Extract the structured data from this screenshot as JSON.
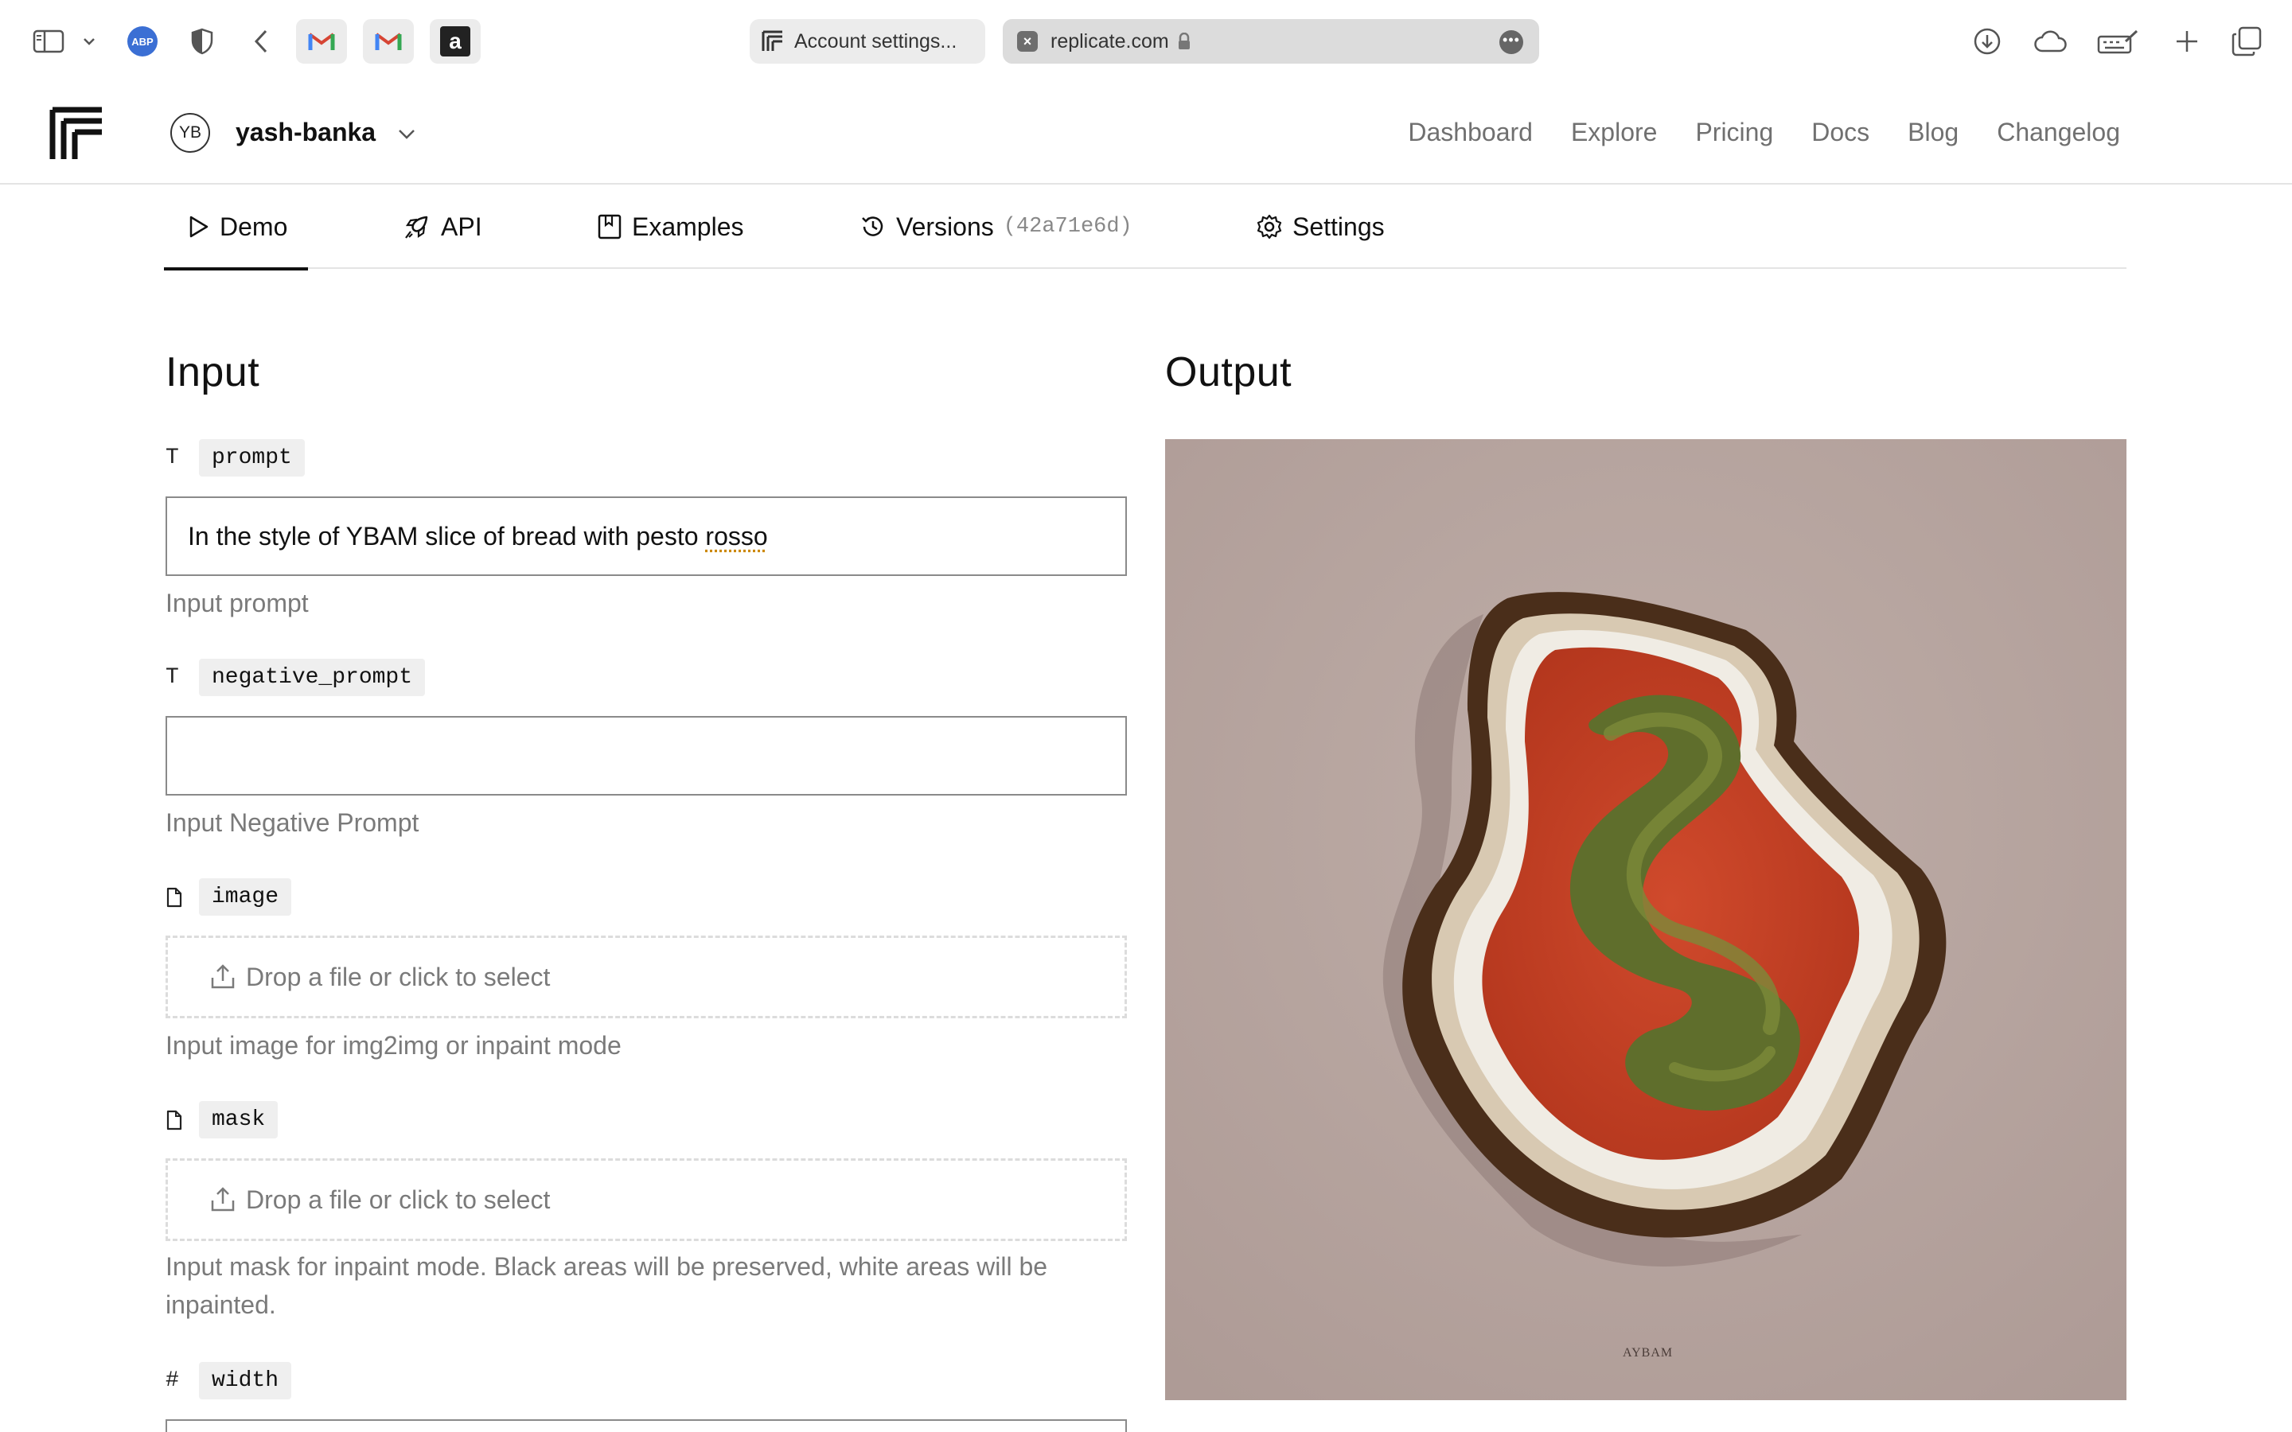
{
  "browser": {
    "tab_inactive_title": "Account settings...",
    "tab_active_url": "replicate.com",
    "adblock_label": "ABP",
    "amazon_label": "a"
  },
  "header": {
    "avatar_initials": "YB",
    "username": "yash-banka",
    "nav": [
      "Dashboard",
      "Explore",
      "Pricing",
      "Docs",
      "Blog",
      "Changelog"
    ]
  },
  "model_tabs": {
    "demo": "Demo",
    "api": "API",
    "examples": "Examples",
    "versions": "Versions",
    "version_hash": "(42a71e6d)",
    "settings": "Settings"
  },
  "input": {
    "title": "Input",
    "fields": {
      "prompt": {
        "type_icon": "T",
        "name": "prompt",
        "value_prefix": "In the style of YBAM slice of bread with pesto ",
        "value_flagged_word": "rosso",
        "hint": "Input prompt"
      },
      "negative_prompt": {
        "type_icon": "T",
        "name": "negative_prompt",
        "value": "",
        "hint": "Input Negative Prompt"
      },
      "image": {
        "name": "image",
        "dropzone": "Drop a file or click to select",
        "hint": "Input image for img2img or inpaint mode"
      },
      "mask": {
        "name": "mask",
        "dropzone": "Drop a file or click to select",
        "hint": "Input mask for inpaint mode. Black areas will be preserved, white areas will be inpainted."
      },
      "width": {
        "type_icon": "#",
        "name": "width"
      }
    }
  },
  "output": {
    "title": "Output",
    "image_signature": "AYBAM",
    "background_color": "#b5a39e"
  }
}
